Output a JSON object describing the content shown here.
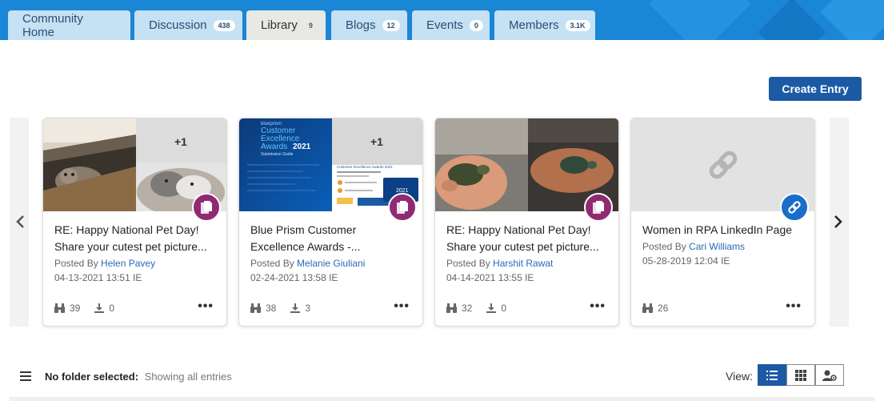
{
  "tabs": [
    {
      "label": "Community Home",
      "badge": ""
    },
    {
      "label": "Discussion",
      "badge": "438"
    },
    {
      "label": "Library",
      "badge": "9"
    },
    {
      "label": "Blogs",
      "badge": "12"
    },
    {
      "label": "Events",
      "badge": "0"
    },
    {
      "label": "Members",
      "badge": "3.1K"
    }
  ],
  "active_tab": "Library",
  "create_button": "Create Entry",
  "cards": [
    {
      "title_line1": "RE: Happy National Pet Day!",
      "title_line2": "Share your cutest pet picture...",
      "posted_prefix": "Posted By ",
      "author": "Helen Pavey",
      "date": "04-13-2021 13:51 IE",
      "views": "39",
      "downloads": "0",
      "extra_count": "+1",
      "type_icon": "document-icon"
    },
    {
      "title_line1": "Blue Prism Customer",
      "title_line2": "Excellence Awards -...",
      "posted_prefix": "Posted By ",
      "author": "Melanie Giuliani",
      "date": "02-24-2021 13:58 IE",
      "views": "38",
      "downloads": "3",
      "extra_count": "+1",
      "type_icon": "document-icon",
      "thumb_text": {
        "brand": "blueprism",
        "heading1": "Customer",
        "heading2": "Excellence",
        "heading3": "Awards",
        "year": "2021",
        "sub": "Submission Guide",
        "side_title": "Customer Excellence Awards 2021",
        "side_year": "2021"
      }
    },
    {
      "title_line1": "RE: Happy National Pet Day!",
      "title_line2": "Share your cutest pet picture...",
      "posted_prefix": "Posted By ",
      "author": "Harshit Rawat",
      "date": "04-14-2021 13:55 IE",
      "views": "32",
      "downloads": "0",
      "type_icon": "document-icon"
    },
    {
      "title_line1": "Women in RPA LinkedIn Page",
      "title_line2": "",
      "posted_prefix": "Posted By ",
      "author": "Cari Williams",
      "date": "05-28-2019 12:04 IE",
      "views": "26",
      "type_icon": "link-icon"
    }
  ],
  "folder_status": {
    "label": "No folder selected:",
    "showing": "Showing all entries"
  },
  "view_label": "View:",
  "view_modes": [
    "list-view-icon",
    "grid-view-icon",
    "user-settings-icon"
  ],
  "active_view": "list-view-icon",
  "colors": {
    "tabbar": "#1a86d6",
    "tab": "#c6e0f4",
    "tab_active": "#e8e8e4",
    "primary_button": "#1c5aa5",
    "doc_badge": "#8f2a73",
    "link_badge": "#1a6ec9",
    "author_link": "#2a6ab8"
  }
}
